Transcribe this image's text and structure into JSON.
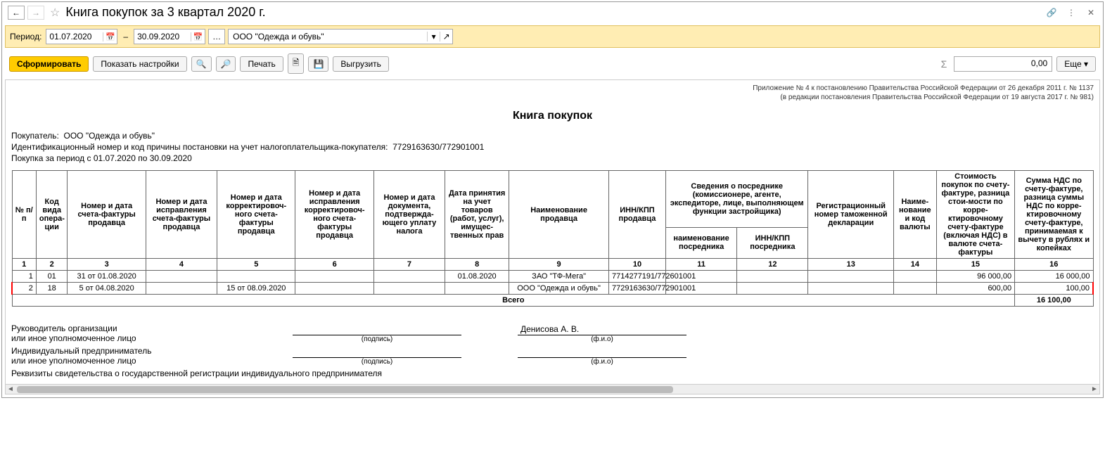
{
  "titlebar": {
    "title": "Книга покупок за 3 квартал 2020 г."
  },
  "filter": {
    "period_label": "Период:",
    "date_from": "01.07.2020",
    "date_to": "30.09.2020",
    "org": "ООО \"Одежда и обувь\""
  },
  "toolbar": {
    "form": "Сформировать",
    "show_settings": "Показать настройки",
    "print": "Печать",
    "upload": "Выгрузить",
    "more": "Еще",
    "sum_symbol": "Σ",
    "sum_value": "0,00"
  },
  "report": {
    "note1": "Приложение № 4 к постановлению Правительства Российской Федерации от 26 декабря 2011 г. № 1137",
    "note2": "(в редакции постановления Правительства Российской Федерации от 19 августа 2017 г. № 981)",
    "title": "Книга покупок",
    "buyer_label": "Покупатель:",
    "buyer": "ООО \"Одежда и обувь\"",
    "inn_label": "Идентификационный номер и код причины постановки на учет налогоплательщика-покупателя:",
    "inn": "7729163630/772901001",
    "period_line": "Покупка за период с 01.07.2020 по 30.09.2020"
  },
  "headers": {
    "c1": "№ п/п",
    "c2": "Код вида опера-ции",
    "c3": "Номер и дата счета-фактуры продавца",
    "c4": "Номер и дата исправления счета-фактуры продавца",
    "c5": "Номер и дата корректировоч-ного счета-фактуры продавца",
    "c6": "Номер и дата исправления корректировоч-ного счета-фактуры продавца",
    "c7": "Номер и дата документа, подтвержда-ющего уплату налога",
    "c8": "Дата принятия на учет товаров (работ, услуг), имущес-твенных прав",
    "c9": "Наименование продавца",
    "c10": "ИНН/КПП продавца",
    "c_med": "Сведения о посреднике (комиссионере, агенте, экспедиторе, лице, выполняющем функции застройщика)",
    "c11": "наименование посредника",
    "c12": "ИНН/КПП посредника",
    "c13": "Регистрационный номер таможенной декларации",
    "c14": "Наиме-нование и код валюты",
    "c15": "Стоимость покупок по счету-фактуре, разница стои-мости по корре-ктировочному счету-фактуре (включая НДС) в валюте счета-фактуры",
    "c16": "Сумма НДС по счету-фактуре, разница суммы НДС по корре-ктировочному счету-фактуре, принимаемая к вычету в рублях и копейках"
  },
  "colnums": [
    "1",
    "2",
    "3",
    "4",
    "5",
    "6",
    "7",
    "8",
    "9",
    "10",
    "11",
    "12",
    "13",
    "14",
    "15",
    "16"
  ],
  "rows": [
    {
      "n": "1",
      "op": "01",
      "inv": "31 от 01.08.2020",
      "corr": "",
      "korr": "",
      "korr2": "",
      "paydoc": "",
      "accept": "01.08.2020",
      "seller": "ЗАО \"ТФ-Мега\"",
      "inn": "7714277191/772601001",
      "med_name": "",
      "med_inn": "",
      "gtd": "",
      "curr": "",
      "cost": "96 000,00",
      "vat": "16 000,00",
      "highlight": false
    },
    {
      "n": "2",
      "op": "18",
      "inv": "5 от 04.08.2020",
      "corr": "",
      "korr": "15 от 08.09.2020",
      "korr2": "",
      "paydoc": "",
      "accept": "",
      "seller": "ООО \"Одежда и обувь\"",
      "inn": "7729163630/772901001",
      "med_name": "",
      "med_inn": "",
      "gtd": "",
      "curr": "",
      "cost": "600,00",
      "vat": "100,00",
      "highlight": true
    }
  ],
  "total": {
    "label": "Всего",
    "vat": "16 100,00"
  },
  "signatures": {
    "head1": "Руководитель организации",
    "head2": "или иное уполномоченное лицо",
    "sign_cap": "(подпись)",
    "fio_cap": "(ф.и.о)",
    "fio_value": "Денисова А. В.",
    "ip1": "Индивидуальный предприниматель",
    "ip2": "или иное уполномоченное лицо",
    "req": "Реквизиты свидетельства о государственной регистрации индивидуального предпринимателя"
  }
}
